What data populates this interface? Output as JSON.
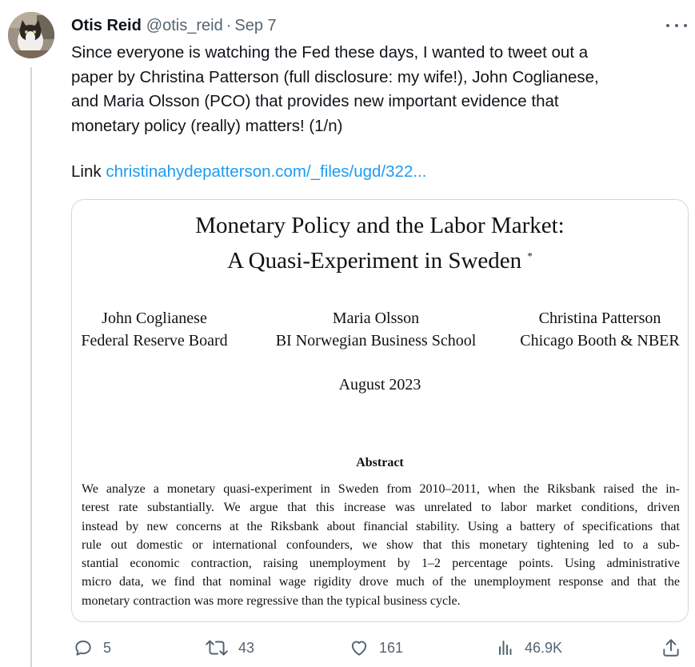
{
  "tweet": {
    "author_name": "Otis Reid",
    "handle": "@otis_reid",
    "date": "Sep 7",
    "text_lines": [
      "Since everyone is watching the Fed these days, I wanted to tweet out a",
      "paper by Christina Patterson (full disclosure: my wife!), John Coglianese,",
      "and Maria Olsson (PCO) that provides new important evidence that",
      "monetary policy (really) matters! (1/n)"
    ],
    "link_prefix": "Link",
    "link_text": "christinahydepatterson.com/_files/ugd/322..."
  },
  "paper": {
    "title_line1": "Monetary Policy and the Labor Market:",
    "title_line2": "A Quasi-Experiment in Sweden",
    "title_mark": "*",
    "authors": [
      {
        "name": "John Coglianese",
        "affiliation": "Federal Reserve Board"
      },
      {
        "name": "Maria Olsson",
        "affiliation": "BI Norwegian Business School"
      },
      {
        "name": "Christina Patterson",
        "affiliation": "Chicago Booth & NBER"
      }
    ],
    "date": "August 2023",
    "abstract_heading": "Abstract",
    "abstract_lines": [
      "We analyze a monetary quasi-experiment in Sweden from 2010–2011, when the Riksbank raised the in-",
      "terest rate substantially. We argue that this increase was unrelated to labor market conditions, driven",
      "instead by new concerns at the Riksbank about financial stability. Using a battery of specifications that",
      "rule out domestic or international confounders, we show that this monetary tightening led to a sub-",
      "stantial economic contraction, raising unemployment by 1–2 percentage points. Using administrative",
      "micro data, we find that nominal wage rigidity drove much of the unemployment response and that the",
      "monetary contraction was more regressive than the typical business cycle."
    ]
  },
  "actions": {
    "replies": "5",
    "reposts": "43",
    "likes": "161",
    "views": "46.9K"
  },
  "icons": [
    "reply-icon",
    "repost-icon",
    "like-icon",
    "views-icon",
    "share-icon",
    "more-icon"
  ],
  "colors": {
    "link": "#1d9bf0",
    "muted": "#536471",
    "border": "#cfd9de"
  }
}
